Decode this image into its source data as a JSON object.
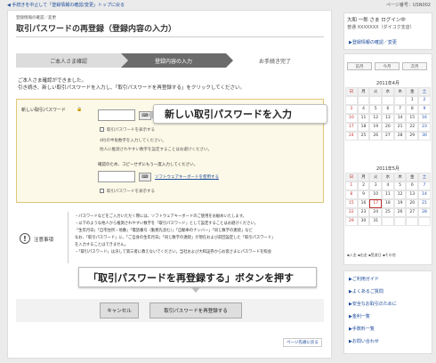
{
  "topbar": {
    "back_link": "◀ 手続きを中止して「登録情報の確認/変更」トップに戻る",
    "page_no": "ページ番号：USN002"
  },
  "breadcrumb": "登録情報の確認／変更",
  "page_title": "取引パスワードの再登録（登録内容の入力）",
  "steps": [
    "ご本人さま確認",
    "登録内容の入力",
    "お手続き完了"
  ],
  "intro": {
    "line1": "ご本人さま確認ができました。",
    "line2": "引き続き、新しい取引パスワードを入力し、「取引パスワードを再登録する」をクリックしてください。"
  },
  "form": {
    "label": "新しい取引パスワード",
    "show_password": "取引パスワードを表示する",
    "hint1": "4桁の半角数字を入力してください。",
    "hint2": "他人に推測されやすい数字を設定することはお避けください。",
    "confirm_text": "確認のため、コピーせずにもう一度入力してください。",
    "soft_keyboard": "ソフトウェアキーボードを使用する",
    "show_password2": "取引パスワードを表示する"
  },
  "callout1": "新しい取引パスワードを入力",
  "notes": {
    "heading": "注意事項",
    "lines": [
      "・パスワードなどをご入力いただく際には、ソフトウェアキーボードのご使用をお勧めいたします。",
      "・以下のような他人から推測されやすい数字を「取引パスワード」として設定することはお避けください。",
      "「生年月日」「自宅住所・地番」「電話番号（勤務先含む）」「自動車のナンバー」「同じ数字の連続」など",
      "なお、「取引パスワード」に、「ご自身の生年月日」「同じ数字の連続」が現在および前回設定した「取引パスワード」",
      "を入力することはできません。",
      "・「取引パスワード」は決して第三者に教えないでください。当社および大和証券からお客さまにパスワードを照会"
    ]
  },
  "callout2": "「取引パスワードを再登録する」ボタンを押す",
  "buttons": {
    "cancel": "キャンセル",
    "reregister": "取引パスワードを再登録する"
  },
  "back_to_top": "ページ先頭に戻る",
  "user": {
    "line1": "大和 一郎 さま  ログイン中",
    "line2": "普通 XXXXXXX（ダイコク支店）",
    "link": "▶登録情報の確認／変更"
  },
  "calendar": {
    "prev": "前月",
    "this": "今月",
    "next": "次月",
    "days": [
      "日",
      "月",
      "火",
      "水",
      "木",
      "金",
      "土"
    ],
    "april": {
      "title": "2011年4月",
      "rows": [
        [
          "",
          "",
          "",
          "",
          "",
          "1",
          "2"
        ],
        [
          "3",
          "4",
          "5",
          "6",
          "7",
          "8",
          "9"
        ],
        [
          "10",
          "11",
          "12",
          "13",
          "14",
          "15",
          "16"
        ],
        [
          "17",
          "18",
          "19",
          "20",
          "21",
          "22",
          "23"
        ],
        [
          "24",
          "25",
          "26",
          "27",
          "28",
          "29",
          "30"
        ]
      ]
    },
    "may": {
      "title": "2011年5月",
      "rows": [
        [
          "1",
          "2",
          "3",
          "4",
          "5",
          "6",
          "7"
        ],
        [
          "8",
          "9",
          "10",
          "11",
          "12",
          "13",
          "14"
        ],
        [
          "15",
          "16",
          "17",
          "18",
          "19",
          "20",
          "21"
        ],
        [
          "22",
          "23",
          "24",
          "25",
          "26",
          "27",
          "28"
        ],
        [
          "29",
          "30",
          "31",
          "",
          "",
          "",
          ""
        ]
      ]
    },
    "legend": "▪入金 ▪出金 ▪受渡日 ▪その他"
  },
  "side_links": [
    "▶ご利用ガイド",
    "▶よくあるご質問",
    "▶安全なお取引のために",
    "▶金利一覧",
    "▶手数料一覧",
    "▶お問い合わせ"
  ]
}
